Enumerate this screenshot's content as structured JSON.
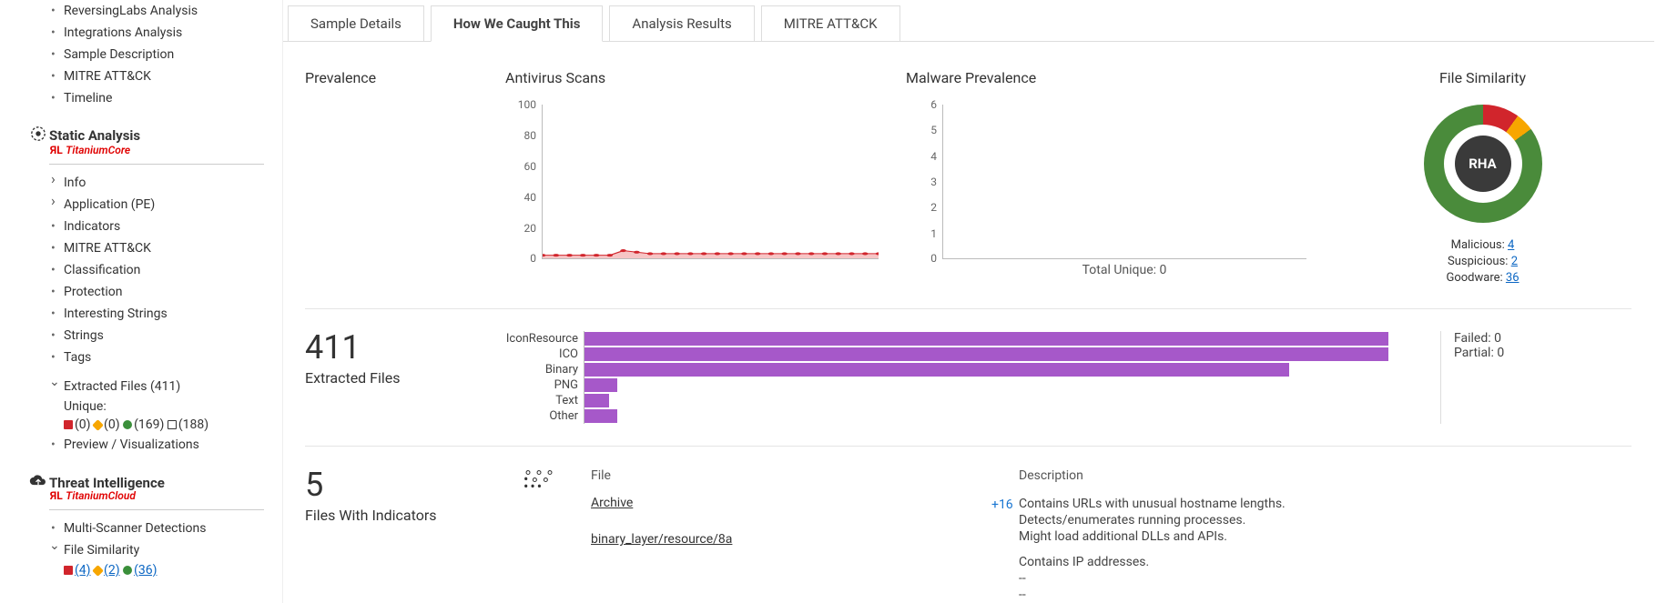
{
  "sidebar": {
    "top_items": [
      "ReversingLabs Analysis",
      "Integrations Analysis",
      "Sample Description",
      "MITRE ATT&CK",
      "Timeline"
    ],
    "static": {
      "title": "Static Analysis",
      "brand_prefix": "RL",
      "product": "TitaniumCore",
      "items": [
        {
          "label": "Info",
          "caret": "right"
        },
        {
          "label": "Application (PE)",
          "caret": "right"
        },
        {
          "label": "Indicators",
          "caret": "none"
        },
        {
          "label": "MITRE ATT&CK",
          "caret": "none"
        },
        {
          "label": "Classification",
          "caret": "none"
        },
        {
          "label": "Protection",
          "caret": "none"
        },
        {
          "label": "Interesting Strings",
          "caret": "none"
        },
        {
          "label": "Strings",
          "caret": "none"
        },
        {
          "label": "Tags",
          "caret": "none"
        }
      ],
      "extracted": {
        "label": "Extracted Files (411)",
        "unique_label": "Unique:",
        "counts": {
          "red": "(0)",
          "orange": "(0)",
          "green": "(169)",
          "open": "(188)"
        }
      },
      "preview": "Preview / Visualizations"
    },
    "ti": {
      "title": "Threat Intelligence",
      "product": "TitaniumCloud",
      "items": [
        {
          "label": "Multi-Scanner Detections",
          "caret": "none"
        },
        {
          "label": "File Similarity",
          "caret": "down"
        }
      ],
      "counts": {
        "red": "(4)",
        "orange": "(2)",
        "green": "(36)"
      }
    }
  },
  "tabs": [
    "Sample Details",
    "How We Caught This",
    "Analysis Results",
    "MITRE ATT&CK"
  ],
  "active_tab": 1,
  "headings": {
    "prevalence": "Prevalence",
    "av": "Antivirus Scans",
    "mp": "Malware Prevalence",
    "fs": "File Similarity"
  },
  "chart_data": [
    {
      "name": "antivirus_scans",
      "type": "line",
      "ylim": [
        0,
        100
      ],
      "yticks": [
        0,
        20,
        40,
        60,
        80,
        100
      ],
      "values": [
        2,
        2,
        2,
        2,
        2,
        2,
        5,
        4,
        3,
        3,
        3,
        3,
        3,
        3,
        3,
        3,
        3,
        3,
        3,
        3,
        3,
        3,
        3,
        3,
        3
      ],
      "fill": "#f6c5c5",
      "stroke": "#d1252c"
    },
    {
      "name": "malware_prevalence",
      "type": "line",
      "ylim": [
        0,
        6
      ],
      "yticks": [
        0,
        1,
        2,
        3,
        4,
        5,
        6
      ],
      "values": [],
      "note": "Total Unique: 0"
    },
    {
      "name": "file_similarity",
      "type": "pie",
      "center_label": "RHA",
      "series": [
        {
          "name": "Malicious",
          "value": 4,
          "color": "#d1252c"
        },
        {
          "name": "Suspicious",
          "value": 2,
          "color": "#f7a600"
        },
        {
          "name": "Goodware",
          "value": 36,
          "color": "#4a8b3b"
        }
      ]
    },
    {
      "name": "extracted_files",
      "type": "bar",
      "orientation": "horizontal",
      "categories": [
        "IconResource",
        "ICO",
        "Binary",
        "PNG",
        "Text",
        "Other"
      ],
      "values": [
        194,
        194,
        170,
        8,
        6,
        8
      ],
      "xlim": [
        0,
        200
      ],
      "fill": "#a658c9"
    }
  ],
  "mp_note": "Total Unique: 0",
  "fs_legend": {
    "malicious": "Malicious:",
    "malicious_v": "4",
    "suspicious": "Suspicious:",
    "suspicious_v": "2",
    "goodware": "Goodware:",
    "goodware_v": "36"
  },
  "fs_center": "RHA",
  "extracted": {
    "count": "411",
    "label": "Extracted Files",
    "failed": "Failed: 0",
    "partial": "Partial: 0"
  },
  "bars": [
    {
      "label": "IconResource",
      "pct": 97
    },
    {
      "label": "ICO",
      "pct": 97
    },
    {
      "label": "Binary",
      "pct": 85
    },
    {
      "label": "PNG",
      "pct": 4
    },
    {
      "label": "Text",
      "pct": 3
    },
    {
      "label": "Other",
      "pct": 4
    }
  ],
  "indicators": {
    "count": "5",
    "label": "Files With Indicators",
    "file_hdr": "File",
    "desc_hdr": "Description",
    "files": [
      "Archive",
      "binary_layer/resource/8a"
    ],
    "plus": "+16",
    "desc": [
      "Contains URLs with unusual hostname lengths.",
      "Detects/enumerates running processes.",
      "Might load additional DLLs and APIs.",
      "",
      "Contains IP addresses.",
      "--",
      "--"
    ]
  }
}
